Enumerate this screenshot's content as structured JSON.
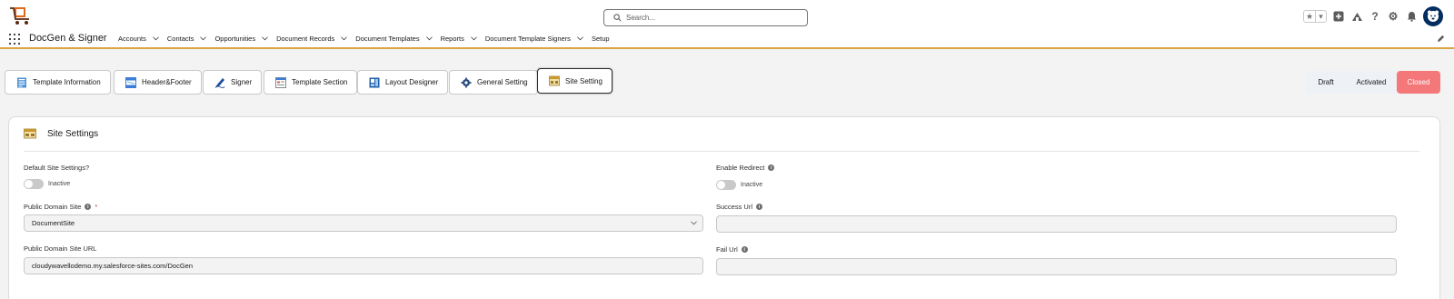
{
  "header": {
    "search_placeholder": "Search..."
  },
  "nav": {
    "app_name": "DocGen & Signer",
    "items": [
      {
        "label": "Accounts",
        "has_menu": true
      },
      {
        "label": "Contacts",
        "has_menu": true
      },
      {
        "label": "Opportunities",
        "has_menu": true
      },
      {
        "label": "Document Records",
        "has_menu": true
      },
      {
        "label": "Document Templates",
        "has_menu": true
      },
      {
        "label": "Reports",
        "has_menu": true
      },
      {
        "label": "Document Template Signers",
        "has_menu": true
      },
      {
        "label": "Setup",
        "has_menu": false
      }
    ]
  },
  "tabs": [
    {
      "label": "Template Information",
      "icon": "template-information-icon"
    },
    {
      "label": "Header&Footer",
      "icon": "header-footer-icon"
    },
    {
      "label": "Signer",
      "icon": "signer-icon"
    },
    {
      "label": "Template Section",
      "icon": "template-section-icon"
    },
    {
      "label": "Layout Designer",
      "icon": "layout-designer-icon"
    },
    {
      "label": "General Setting",
      "icon": "gear-icon"
    },
    {
      "label": "Site Setting",
      "icon": "site-setting-icon",
      "active": true
    }
  ],
  "status": {
    "draft": "Draft",
    "activated": "Activated",
    "closed": "Closed",
    "current": "Closed"
  },
  "site_settings": {
    "title": "Site Settings",
    "default_site_label": "Default Site Settings?",
    "default_site_state": "Inactive",
    "enable_redirect_label": "Enable Redirect",
    "enable_redirect_state": "Inactive",
    "public_domain_site_label": "Public Domain Site",
    "public_domain_site_value": "DocumentSite",
    "public_domain_site_url_label": "Public Domain Site URL",
    "public_domain_site_url_value": "cloudywavellodemo.my.salesforce-sites.com/DocGen",
    "success_url_label": "Success Url",
    "success_url_value": "",
    "fail_url_label": "Fail Url",
    "fail_url_value": ""
  },
  "colors": {
    "nav_underline": "#d9a441",
    "closed_status": "#f4777a",
    "avatar_bg": "#032d60"
  }
}
